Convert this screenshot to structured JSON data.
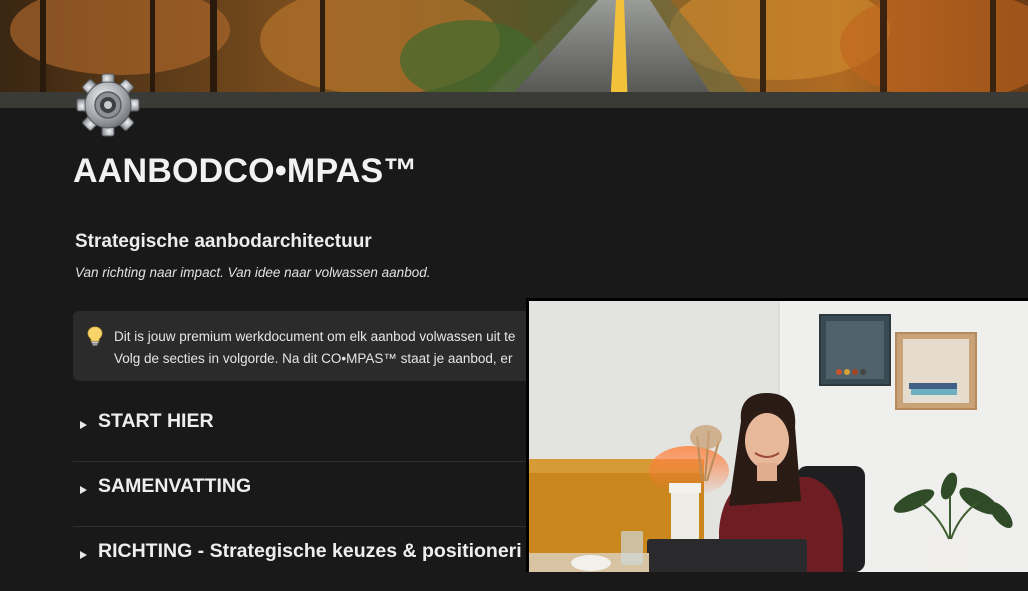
{
  "cover": {
    "image": "autumn-forest-road-photo"
  },
  "page_icon": {
    "icon": "gear-icon"
  },
  "page": {
    "title": "AANBODCO•MPAS™",
    "subtitle": "Strategische aanbodarchitectuur",
    "tagline": "Van richting naar impact. Van idee naar volwassen aanbod."
  },
  "callout": {
    "icon": "lightbulb-icon",
    "line1": "Dit is jouw premium werkdocument om elk aanbod volwassen uit te",
    "line2": "Volg de secties in volgorde. Na dit CO•MPAS™  staat je aanbod, er"
  },
  "toggles": [
    {
      "label": "START HIER"
    },
    {
      "label": "SAMENVATTING"
    },
    {
      "label": "RICHTING - Strategische keuzes & positioneri"
    }
  ],
  "video_overlay": {
    "content": "webcam-presenter"
  },
  "colors": {
    "background": "#191919",
    "callout_bg": "#2b2b2b",
    "text": "#ebebeb",
    "divider": "#2f2f2f"
  }
}
